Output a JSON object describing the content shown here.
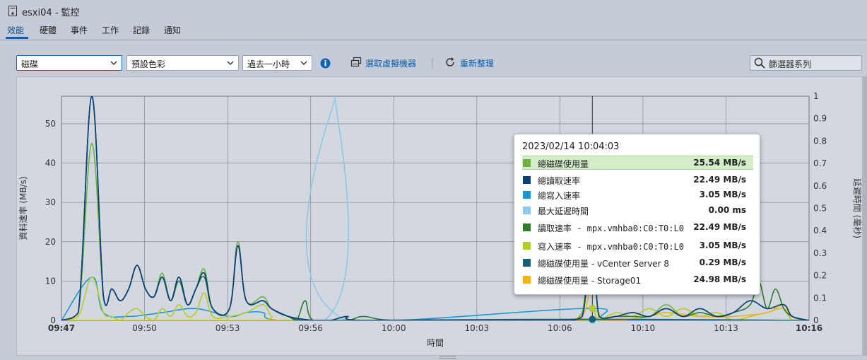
{
  "window": {
    "title": "esxi04 - 監控"
  },
  "tabs": [
    {
      "label": "效能"
    },
    {
      "label": "硬體"
    },
    {
      "label": "事件"
    },
    {
      "label": "工作"
    },
    {
      "label": "記錄"
    },
    {
      "label": "通知"
    }
  ],
  "toolbar": {
    "metric_value": "磁碟",
    "color_value": "預設色彩",
    "timespan_value": "過去一小時",
    "select_vm_label": "選取虛擬機器",
    "refresh_label": "重新整理",
    "filter_placeholder": "篩選器系列"
  },
  "chart_data": {
    "type": "line",
    "ylabel": "資料速率 (MB/s)",
    "ylabel2": "延遲時間 (毫秒)",
    "xlabel": "時間",
    "ylim": [
      0,
      57
    ],
    "y2lim": [
      0,
      1
    ],
    "x_tick_labels": [
      "09:47",
      "09:50",
      "09:53",
      "09:56",
      "10:00",
      "10:03",
      "10:06",
      "10:10",
      "10:13",
      "10:16"
    ],
    "y_ticks": [
      0,
      10,
      20,
      30,
      40,
      50
    ],
    "y2_ticks": [
      0,
      0.1,
      0.2,
      0.3,
      0.4,
      0.5,
      0.6,
      0.7,
      0.8,
      0.9,
      1
    ],
    "x_minutes_range": [
      0,
      89
    ],
    "hover_minute": 63.2,
    "series": [
      {
        "name": "總磁碟使用量",
        "color": "#6cb43f",
        "points": [
          [
            0,
            0
          ],
          [
            2,
            2
          ],
          [
            3.6,
            45
          ],
          [
            5,
            6
          ],
          [
            6,
            8
          ],
          [
            7,
            5
          ],
          [
            8,
            8
          ],
          [
            9,
            14
          ],
          [
            10,
            8
          ],
          [
            11,
            6
          ],
          [
            12,
            12
          ],
          [
            13,
            5
          ],
          [
            14,
            11
          ],
          [
            15,
            4
          ],
          [
            16,
            8
          ],
          [
            17,
            13
          ],
          [
            18,
            3
          ],
          [
            20,
            3
          ],
          [
            21,
            20
          ],
          [
            22,
            5
          ],
          [
            24,
            6
          ],
          [
            25,
            3
          ],
          [
            27,
            1
          ],
          [
            30,
            0
          ],
          [
            32,
            0
          ],
          [
            34,
            1
          ],
          [
            36,
            0
          ],
          [
            55,
            0
          ],
          [
            60,
            0
          ],
          [
            62,
            2
          ],
          [
            63.2,
            25.5
          ],
          [
            64,
            1
          ],
          [
            66,
            1
          ],
          [
            68,
            2
          ],
          [
            70,
            1
          ],
          [
            72,
            4
          ],
          [
            74,
            1
          ],
          [
            76,
            3
          ],
          [
            78,
            1
          ],
          [
            80,
            2
          ],
          [
            82,
            5
          ],
          [
            84,
            3
          ],
          [
            86,
            4
          ],
          [
            87,
            1
          ],
          [
            89,
            0
          ]
        ]
      },
      {
        "name": "總讀取速率",
        "color": "#0b3f7a",
        "points": [
          [
            0,
            0
          ],
          [
            2,
            2
          ],
          [
            3.6,
            57
          ],
          [
            5,
            6
          ],
          [
            6,
            8
          ],
          [
            7,
            5
          ],
          [
            8,
            8
          ],
          [
            9,
            14
          ],
          [
            10,
            8
          ],
          [
            11,
            6
          ],
          [
            12,
            11
          ],
          [
            13,
            5
          ],
          [
            14,
            11
          ],
          [
            15,
            4
          ],
          [
            16,
            8
          ],
          [
            17,
            12
          ],
          [
            18,
            3
          ],
          [
            20,
            3
          ],
          [
            21,
            19
          ],
          [
            22,
            5
          ],
          [
            24,
            5
          ],
          [
            25,
            3
          ],
          [
            27,
            1
          ],
          [
            30,
            0
          ],
          [
            32,
            0
          ],
          [
            34,
            1
          ],
          [
            36,
            0
          ],
          [
            55,
            0
          ],
          [
            60,
            0
          ],
          [
            62,
            1
          ],
          [
            63.2,
            22.5
          ],
          [
            64,
            1
          ],
          [
            66,
            1
          ],
          [
            68,
            2
          ],
          [
            70,
            1
          ],
          [
            72,
            3
          ],
          [
            74,
            1
          ],
          [
            76,
            3
          ],
          [
            78,
            1
          ],
          [
            80,
            2
          ],
          [
            82,
            5
          ],
          [
            84,
            3
          ],
          [
            86,
            4
          ],
          [
            87,
            1
          ],
          [
            89,
            0
          ]
        ]
      },
      {
        "name": "總寫入速率",
        "color": "#1897d6",
        "points": [
          [
            0,
            0
          ],
          [
            3.6,
            11
          ],
          [
            5,
            2
          ],
          [
            8,
            1
          ],
          [
            12,
            2
          ],
          [
            16,
            3
          ],
          [
            20,
            1
          ],
          [
            22,
            2
          ],
          [
            24,
            2
          ],
          [
            26,
            0
          ],
          [
            40,
            0
          ],
          [
            63.2,
            3.05
          ],
          [
            66,
            0
          ],
          [
            89,
            0
          ]
        ]
      },
      {
        "name": "最大延遲時間",
        "color": "#8cc9e6",
        "axis": "right",
        "points": [
          [
            0,
            0
          ],
          [
            31.3,
            0
          ],
          [
            32.6,
            1
          ],
          [
            33.9,
            0
          ],
          [
            89,
            0
          ]
        ]
      },
      {
        "name": "讀取速率 - mpx.vmhba0:C0:T0:L0",
        "color": "#2e7d2e",
        "points": [
          [
            0,
            0
          ],
          [
            2,
            2
          ],
          [
            3.6,
            57
          ],
          [
            5,
            6
          ],
          [
            6,
            8
          ],
          [
            7,
            5
          ],
          [
            8,
            8
          ],
          [
            9,
            14
          ],
          [
            10,
            8
          ],
          [
            11,
            6
          ],
          [
            12,
            11
          ],
          [
            13,
            5
          ],
          [
            14,
            10
          ],
          [
            15,
            4
          ],
          [
            16,
            8
          ],
          [
            17,
            11
          ],
          [
            18,
            3
          ],
          [
            20,
            3
          ],
          [
            21,
            19
          ],
          [
            22,
            5
          ],
          [
            24,
            5
          ],
          [
            25,
            3
          ],
          [
            27,
            1
          ],
          [
            28,
            0
          ],
          [
            29,
            5
          ],
          [
            30,
            0
          ],
          [
            34,
            0
          ],
          [
            36,
            1
          ],
          [
            40,
            0
          ],
          [
            55,
            0
          ],
          [
            60,
            0
          ],
          [
            62,
            1
          ],
          [
            63.2,
            22.5
          ],
          [
            64,
            1
          ],
          [
            66,
            1
          ],
          [
            68,
            1
          ],
          [
            70,
            1
          ],
          [
            72,
            3
          ],
          [
            74,
            1
          ],
          [
            76,
            2
          ],
          [
            78,
            1
          ],
          [
            80,
            2
          ],
          [
            82,
            4
          ],
          [
            83,
            10
          ],
          [
            84,
            3
          ],
          [
            85,
            8
          ],
          [
            86,
            3
          ],
          [
            87,
            1
          ],
          [
            89,
            0
          ]
        ]
      },
      {
        "name": "寫入速率 - mpx.vmhba0:C0:T0:L0",
        "color": "#b5cc2a",
        "points": [
          [
            0,
            0
          ],
          [
            2,
            1
          ],
          [
            3.6,
            11
          ],
          [
            5,
            2
          ],
          [
            6,
            1
          ],
          [
            7,
            0
          ],
          [
            8,
            2
          ],
          [
            9,
            3
          ],
          [
            10,
            1
          ],
          [
            11,
            0
          ],
          [
            12,
            3
          ],
          [
            13,
            1
          ],
          [
            14,
            4
          ],
          [
            15,
            1
          ],
          [
            16,
            2
          ],
          [
            17,
            7
          ],
          [
            18,
            1
          ],
          [
            20,
            1
          ],
          [
            22,
            2
          ],
          [
            24,
            4
          ],
          [
            25,
            1
          ],
          [
            26,
            0
          ],
          [
            40,
            0
          ],
          [
            62,
            0
          ],
          [
            63.2,
            3.05
          ],
          [
            64,
            0
          ],
          [
            66,
            2
          ],
          [
            68,
            1
          ],
          [
            70,
            3
          ],
          [
            72,
            1
          ],
          [
            74,
            3
          ],
          [
            76,
            1
          ],
          [
            78,
            2
          ],
          [
            80,
            0
          ],
          [
            82,
            1
          ],
          [
            84,
            2
          ],
          [
            86,
            3
          ],
          [
            87,
            0
          ],
          [
            89,
            0
          ]
        ]
      },
      {
        "name": "總磁碟使用量 - vCenter Server 8",
        "color": "#14617a",
        "points": [
          [
            0,
            0
          ],
          [
            2,
            2
          ],
          [
            3.6,
            57
          ],
          [
            5,
            6
          ],
          [
            6,
            8
          ],
          [
            7,
            5
          ],
          [
            8,
            8
          ],
          [
            9,
            14
          ],
          [
            10,
            8
          ],
          [
            11,
            6
          ],
          [
            12,
            11
          ],
          [
            13,
            5
          ],
          [
            14,
            11
          ],
          [
            15,
            4
          ],
          [
            16,
            8
          ],
          [
            17,
            12
          ],
          [
            18,
            3
          ],
          [
            20,
            3
          ],
          [
            21,
            19
          ],
          [
            22,
            5
          ],
          [
            24,
            5
          ],
          [
            25,
            3
          ],
          [
            27,
            1
          ],
          [
            29,
            0
          ],
          [
            35,
            0
          ],
          [
            63.2,
            0.29
          ],
          [
            89,
            0
          ]
        ]
      },
      {
        "name": "總磁碟使用量 - Storage01",
        "color": "#f3b21b",
        "points": [
          [
            0,
            0
          ],
          [
            55,
            0
          ],
          [
            62,
            1
          ],
          [
            63.2,
            25.0
          ],
          [
            64,
            1
          ],
          [
            66,
            0
          ],
          [
            70,
            1
          ],
          [
            72,
            2
          ],
          [
            76,
            1
          ],
          [
            80,
            1
          ],
          [
            84,
            2
          ],
          [
            86,
            4
          ],
          [
            87,
            0
          ],
          [
            89,
            0
          ]
        ]
      }
    ]
  },
  "tooltip": {
    "timestamp": "2023/02/14 10:04:03",
    "rows": [
      {
        "name": "總磁碟使用量",
        "value": "25.54 MB/s",
        "color": "#6cb43f"
      },
      {
        "name": "總讀取速率",
        "value": "22.49 MB/s",
        "color": "#0b3f7a"
      },
      {
        "name": "總寫入速率",
        "value": "3.05 MB/s",
        "color": "#1897d6"
      },
      {
        "name": "最大延遲時間",
        "value": "0.00 ms",
        "color": "#8cc9e6"
      },
      {
        "name": "讀取速率 - mpx.vmhba0:C0:T0:L0",
        "value": "22.49 MB/s",
        "color": "#2e7d2e"
      },
      {
        "name": "寫入速率 - mpx.vmhba0:C0:T0:L0",
        "value": "3.05 MB/s",
        "color": "#b5cc2a"
      },
      {
        "name": "總磁碟使用量 - vCenter Server 8",
        "value": "0.29 MB/s",
        "color": "#14617a"
      },
      {
        "name": "總磁碟使用量 - Storage01",
        "value": "24.98 MB/s",
        "color": "#f3b21b"
      }
    ]
  }
}
